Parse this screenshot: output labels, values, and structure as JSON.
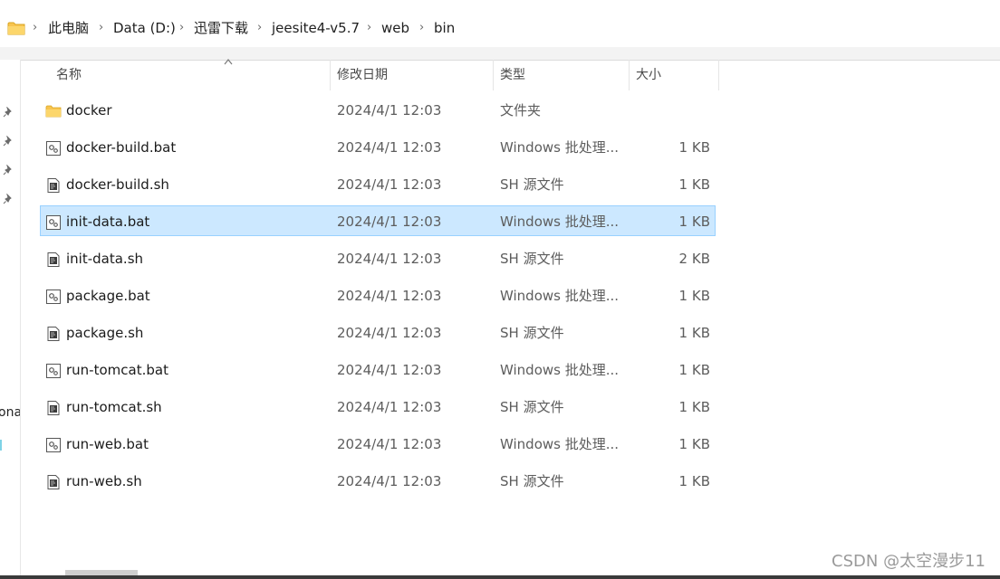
{
  "breadcrumb": {
    "items": [
      "此电脑",
      "Data (D:)",
      "迅雷下载",
      "jeesite4-v5.7",
      "web",
      "bin"
    ],
    "separator": "›"
  },
  "nav_pane": {
    "partial_label": "ona"
  },
  "columns": {
    "name": "名称",
    "modified": "修改日期",
    "type": "类型",
    "size": "大小"
  },
  "files": [
    {
      "name": "docker",
      "modified": "2024/4/1 12:03",
      "type": "文件夹",
      "size": "",
      "icon": "folder-icon"
    },
    {
      "name": "docker-build.bat",
      "modified": "2024/4/1 12:03",
      "type": "Windows 批处理...",
      "size": "1 KB",
      "icon": "batch-file-icon"
    },
    {
      "name": "docker-build.sh",
      "modified": "2024/4/1 12:03",
      "type": "SH 源文件",
      "size": "1 KB",
      "icon": "script-file-icon"
    },
    {
      "name": "init-data.bat",
      "modified": "2024/4/1 12:03",
      "type": "Windows 批处理...",
      "size": "1 KB",
      "icon": "batch-file-icon",
      "selected": true
    },
    {
      "name": "init-data.sh",
      "modified": "2024/4/1 12:03",
      "type": "SH 源文件",
      "size": "2 KB",
      "icon": "script-file-icon"
    },
    {
      "name": "package.bat",
      "modified": "2024/4/1 12:03",
      "type": "Windows 批处理...",
      "size": "1 KB",
      "icon": "batch-file-icon"
    },
    {
      "name": "package.sh",
      "modified": "2024/4/1 12:03",
      "type": "SH 源文件",
      "size": "1 KB",
      "icon": "script-file-icon"
    },
    {
      "name": "run-tomcat.bat",
      "modified": "2024/4/1 12:03",
      "type": "Windows 批处理...",
      "size": "1 KB",
      "icon": "batch-file-icon"
    },
    {
      "name": "run-tomcat.sh",
      "modified": "2024/4/1 12:03",
      "type": "SH 源文件",
      "size": "1 KB",
      "icon": "script-file-icon"
    },
    {
      "name": "run-web.bat",
      "modified": "2024/4/1 12:03",
      "type": "Windows 批处理...",
      "size": "1 KB",
      "icon": "batch-file-icon"
    },
    {
      "name": "run-web.sh",
      "modified": "2024/4/1 12:03",
      "type": "SH 源文件",
      "size": "1 KB",
      "icon": "script-file-icon"
    }
  ],
  "watermark": "CSDN @太空漫步11",
  "colors": {
    "selection_bg": "#cce8ff",
    "selection_border": "#99d1ff",
    "folder_yellow": "#f8c44f"
  }
}
